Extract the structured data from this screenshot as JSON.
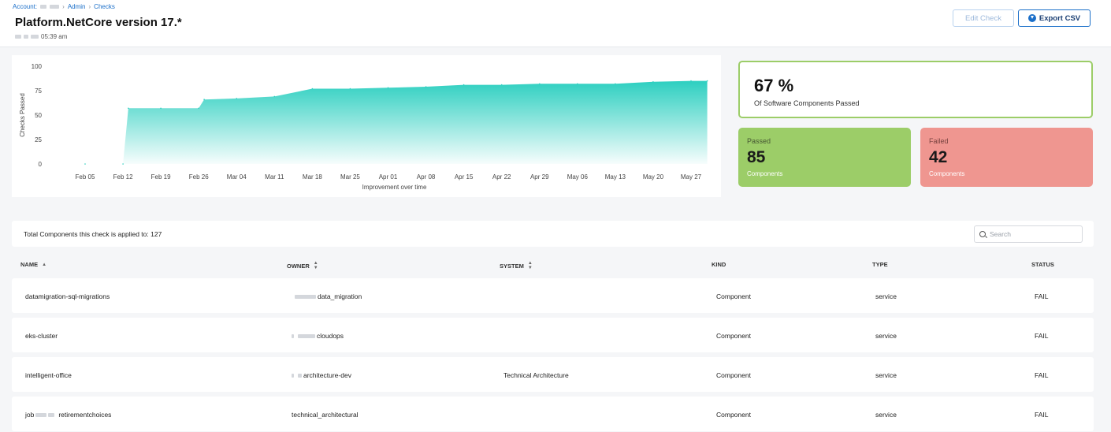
{
  "breadcrumb": {
    "account_label": "Account:",
    "admin": "Admin",
    "checks": "Checks"
  },
  "page": {
    "title": "Platform.NetCore version 17.*",
    "timestamp": "05:39 am"
  },
  "toolbar": {
    "edit_label": "Edit Check",
    "export_label": "Export CSV"
  },
  "colors": {
    "accent": "#1b6fc9",
    "area": "#2dcfc0",
    "passed": "#9ccd68",
    "failed": "#ef9690"
  },
  "chart_data": {
    "type": "area",
    "ylabel": "Checks Passed",
    "xlabel": "Improvement over time",
    "ylim": [
      0,
      100
    ],
    "yticks": [
      0,
      25,
      50,
      75,
      100
    ],
    "x_tick_labels": [
      "Feb 05",
      "Feb 12",
      "Feb 19",
      "Feb 26",
      "Mar 04",
      "Mar 11",
      "Mar 18",
      "Mar 25",
      "Apr 01",
      "Apr 08",
      "Apr 15",
      "Apr 22",
      "Apr 29",
      "May 06",
      "May 13",
      "May 20",
      "May 27"
    ],
    "x": [
      "Feb 05",
      "Feb 12",
      "Feb 13",
      "Feb 19",
      "Feb 26",
      "Feb 27",
      "Mar 04",
      "Mar 11",
      "Mar 18",
      "Mar 25",
      "Apr 01",
      "Apr 08",
      "Apr 15",
      "Apr 22",
      "Apr 29",
      "May 06",
      "May 13",
      "May 20",
      "May 27",
      "May 30"
    ],
    "values": [
      0,
      0,
      57,
      57,
      57,
      66,
      67,
      69,
      77,
      77,
      78,
      79,
      81,
      81,
      82,
      82,
      82,
      84,
      85,
      85
    ],
    "grid": false,
    "legend": "none"
  },
  "summary": {
    "percent": "67 %",
    "percent_label": "Of Software Components Passed"
  },
  "passed": {
    "title": "Passed",
    "count": "85",
    "sub": "Components"
  },
  "failed": {
    "title": "Failed",
    "count": "42",
    "sub": "Components"
  },
  "table": {
    "total_text": "Total Components this check is applied to: 127",
    "search_placeholder": "Search",
    "headers": {
      "name": "NAME",
      "owner": "OWNER",
      "system": "SYSTEM",
      "kind": "KIND",
      "type": "TYPE",
      "status": "STATUS"
    },
    "rows": [
      {
        "name": "datamigration-sql-migrations",
        "owner": "data_migration",
        "system": "",
        "kind": "Component",
        "type": "service",
        "status": "FAIL"
      },
      {
        "name": "eks-cluster",
        "owner": "cloudops",
        "system": "",
        "kind": "Component",
        "type": "service",
        "status": "FAIL"
      },
      {
        "name": "intelligent-office",
        "owner": "architecture-dev",
        "system": "Technical Architecture",
        "kind": "Component",
        "type": "service",
        "status": "FAIL"
      },
      {
        "name": "retirementchoices",
        "name_prefix": "job",
        "owner": "technical_architectural",
        "system": "",
        "kind": "Component",
        "type": "service",
        "status": "FAIL"
      }
    ]
  }
}
